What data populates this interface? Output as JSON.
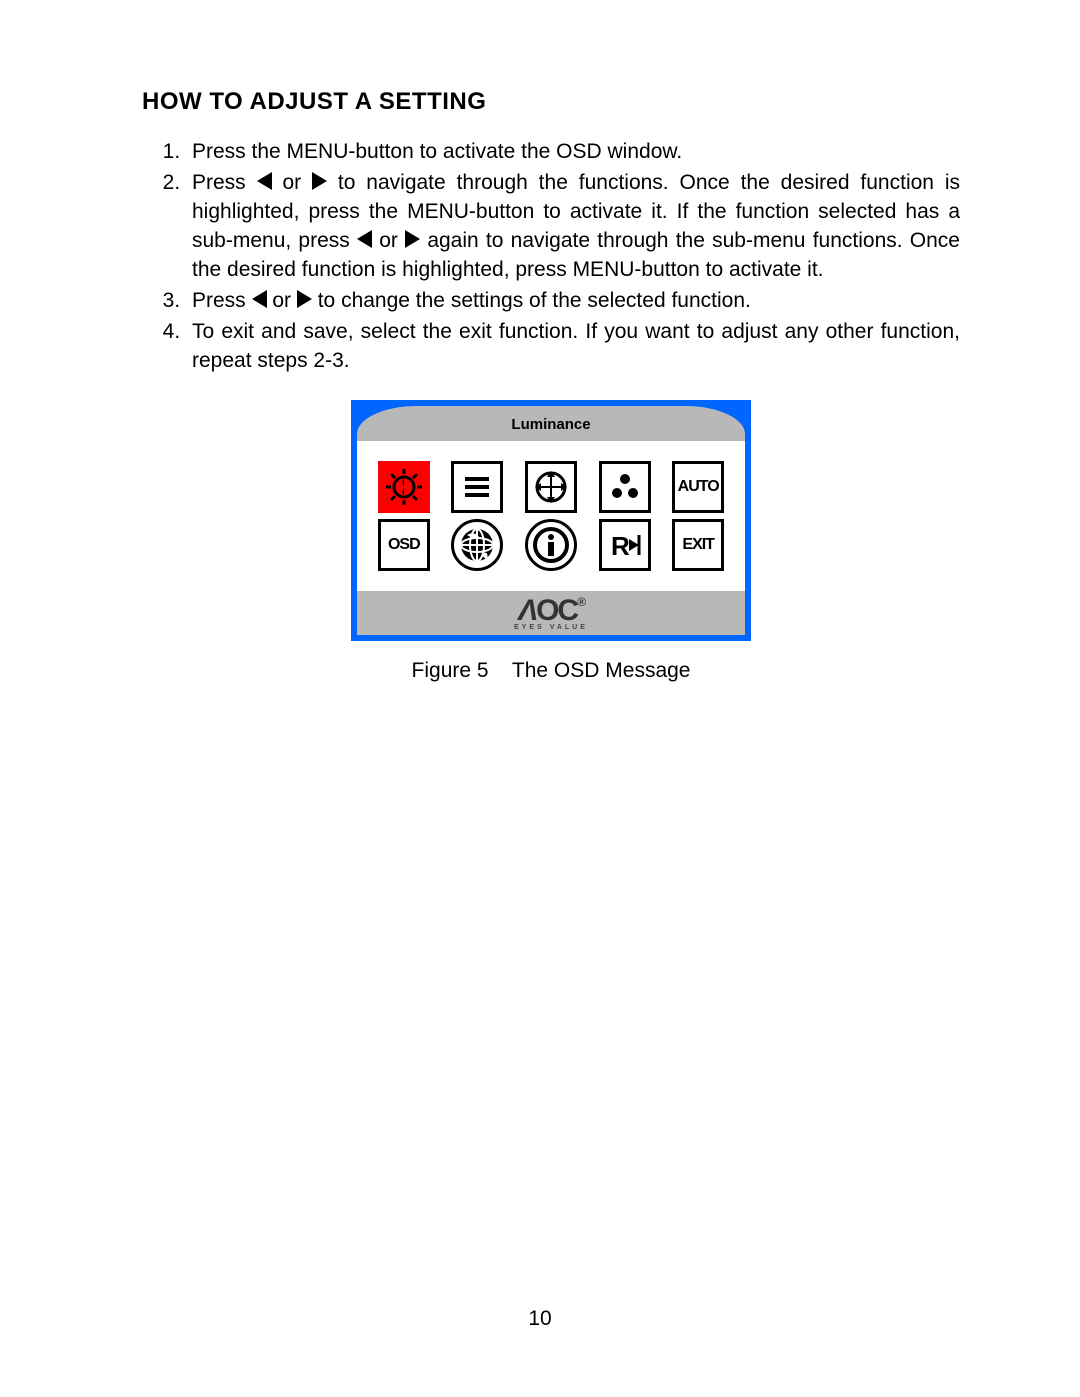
{
  "heading": "HOW TO ADJUST A SETTING",
  "steps": {
    "s1": "Press the MENU-button to activate the OSD window.",
    "s2a": "Press ",
    "s2b": "or ",
    "s2c": " to navigate through the functions. Once the desired function is highlighted, press the MENU-button  to activate it.  If the function selected has a sub-menu, press ",
    "s2d": " or ",
    "s2e": " again to navigate through the sub-menu functions.   Once the desired function is highlighted, press MENU-button to activate it.",
    "s3a": "Press  ",
    "s3b": " or ",
    "s3c": " to change the settings of the selected function.",
    "s4": "To exit and save, select the exit function. If you want to adjust any other function, repeat steps 2-3."
  },
  "osd": {
    "header": "Luminance",
    "icons": [
      [
        "luminance",
        "image-setup",
        "position",
        "color-temp",
        "auto"
      ],
      [
        "osd-setup",
        "language",
        "information",
        "reset",
        "exit"
      ]
    ],
    "labels": {
      "auto": "AUTO",
      "osd": "OSD",
      "exit": "EXIT"
    },
    "brand": "AOC",
    "brandSub": "EYES VALUE"
  },
  "figure": {
    "label": "Figure 5",
    "text": "The  OSD  Message"
  },
  "pageNumber": "10"
}
